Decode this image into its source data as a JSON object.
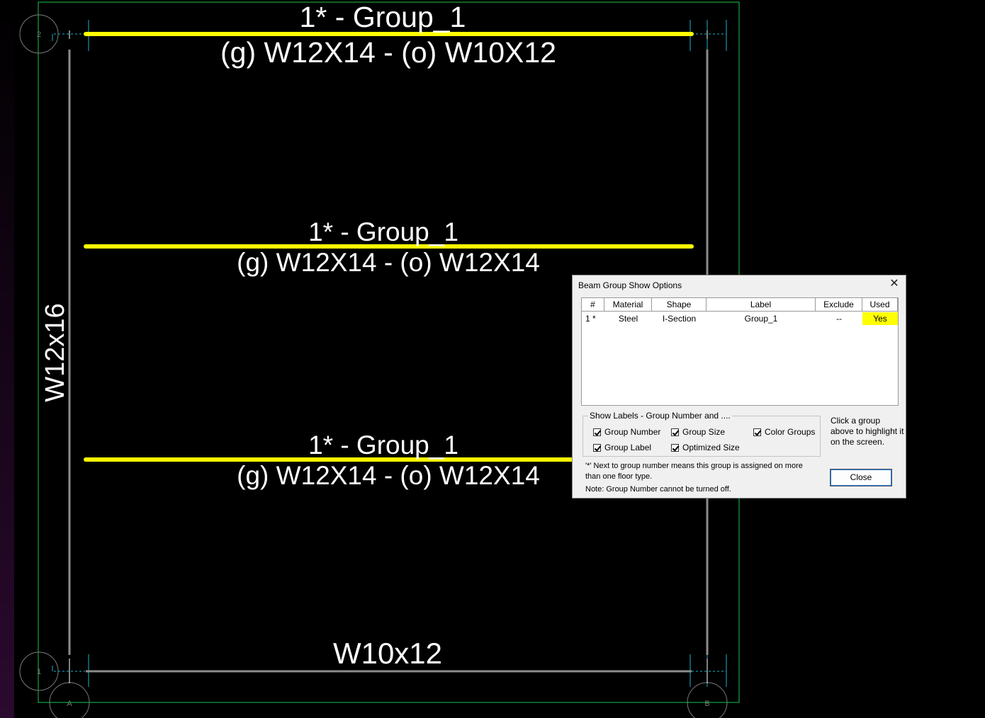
{
  "drawing": {
    "beams": [
      {
        "group_label": "1* - Group_1",
        "size_label": "(g) W12X14 - (o) W10X12"
      },
      {
        "group_label": "1* - Group_1",
        "size_label": "(g) W12X14 - (o) W12X14"
      },
      {
        "group_label": "1* - Group_1",
        "size_label": "(g) W12X14 - (o) W12X14"
      }
    ],
    "bottom_beam_label": "W10x12",
    "left_column_label": "W12x16",
    "grid_labels": {
      "top_left": "2",
      "bottom_left": "1",
      "bottom_a": "A",
      "bottom_b": "B"
    },
    "colors": {
      "highlight": "#ffff00",
      "boundary": "#19c84a",
      "dimension": "#1ab2c7",
      "member": "#8c8c8c"
    }
  },
  "dialog": {
    "title": "Beam Group Show Options",
    "close_icon": "close-icon",
    "columns": [
      "#",
      "Material",
      "Shape",
      "Label",
      "Exclude",
      "Used"
    ],
    "rows": [
      {
        "num": "1 *",
        "material": "Steel",
        "shape": "I-Section",
        "label": "Group_1",
        "exclude": "--",
        "used": "Yes"
      }
    ],
    "show_labels_title": "Show Labels - Group Number and ....",
    "checkboxes": {
      "group_number": "Group Number",
      "group_size": "Group Size",
      "color_groups": "Color Groups",
      "group_label": "Group Label",
      "optimized_size": "Optimized Size"
    },
    "hint": "Click a group above to highlight it on the screen.",
    "note1": "'*' Next to group number means this group is assigned on more than one floor type.",
    "note2": "Note: Group Number cannot be turned off.",
    "close_button": "Close"
  }
}
